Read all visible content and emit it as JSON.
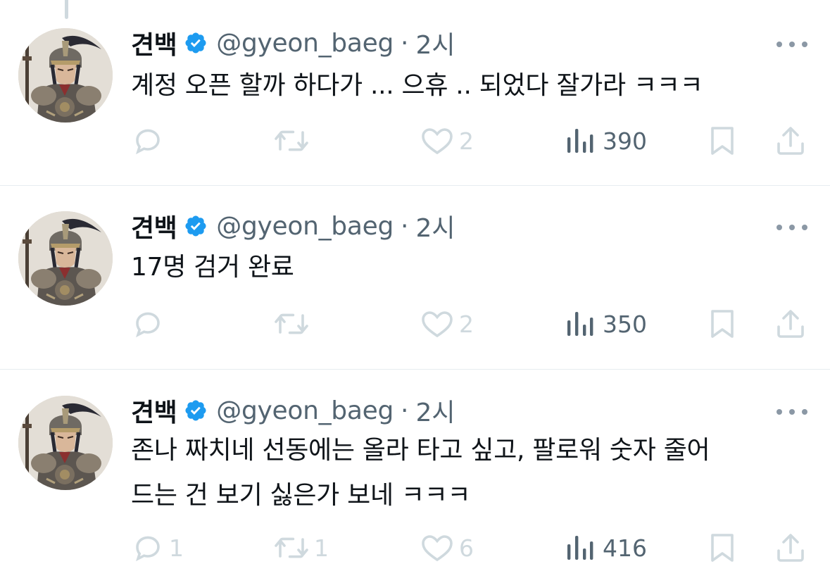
{
  "app": {
    "accent": "#1d9bf0",
    "muted": "#536471",
    "faded_icon": "#cfd9de"
  },
  "tweets": [
    {
      "author_name": "견백",
      "handle": "@gyeon_baeg",
      "separator": "·",
      "time": "2시",
      "text_lines": [
        "계정 오픈 할까 하다가 ... 으휴 .. 되었다 잘가라 ㅋㅋㅋ"
      ],
      "replies": "",
      "retweets": "",
      "likes": "2",
      "views": "390"
    },
    {
      "author_name": "견백",
      "handle": "@gyeon_baeg",
      "separator": "·",
      "time": "2시",
      "text_lines": [
        "17명 검거 완료"
      ],
      "replies": "",
      "retweets": "",
      "likes": "2",
      "views": "350"
    },
    {
      "author_name": "견백",
      "handle": "@gyeon_baeg",
      "separator": "·",
      "time": "2시",
      "text_lines": [
        "존나 짜치네 선동에는 올라 타고 싶고, 팔로워 숫자 줄어",
        "드는 건 보기 싫은가 보네 ㅋㅋㅋ"
      ],
      "replies": "1",
      "retweets": "1",
      "likes": "6",
      "views": "416"
    }
  ],
  "icons": {
    "verified": "verified-badge-icon",
    "more": "more-dots-icon",
    "reply": "reply-icon",
    "retweet": "retweet-icon",
    "like": "heart-icon",
    "views": "views-bar-chart-icon",
    "bookmark": "bookmark-icon",
    "share": "share-icon"
  }
}
